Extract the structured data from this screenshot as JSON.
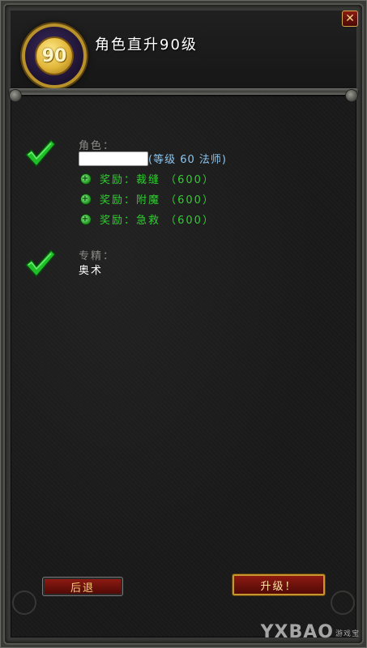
{
  "dialog": {
    "title": "角色直升90级",
    "medallion_level": "90",
    "close_glyph": "✕"
  },
  "character": {
    "label": "角色：",
    "name_value": "",
    "info": "(等级 60 法师)"
  },
  "rewards": [
    {
      "text": "奖励：裁缝 （600）"
    },
    {
      "text": "奖励：附魔 （600）"
    },
    {
      "text": "奖励：急救 （600）"
    }
  ],
  "specialization": {
    "label": "专精：",
    "value": "奥术"
  },
  "buttons": {
    "back": "后退",
    "upgrade": "升级！"
  },
  "watermark": {
    "text": "YXBAO",
    "sub": "游戏宝"
  },
  "icons": {
    "check": "checkmark-icon",
    "bullet": "plus-bullet-icon",
    "close": "close-icon"
  },
  "colors": {
    "title": "#ffffff",
    "reward_green": "#2fcf2f",
    "info_blue": "#8cc6ee",
    "label_gray": "#8a8a86",
    "check_green": "#1fbf2a",
    "button_red": "#8c1a12",
    "button_text_gold": "#f4d27a",
    "frame_gold": "#b8912a"
  }
}
